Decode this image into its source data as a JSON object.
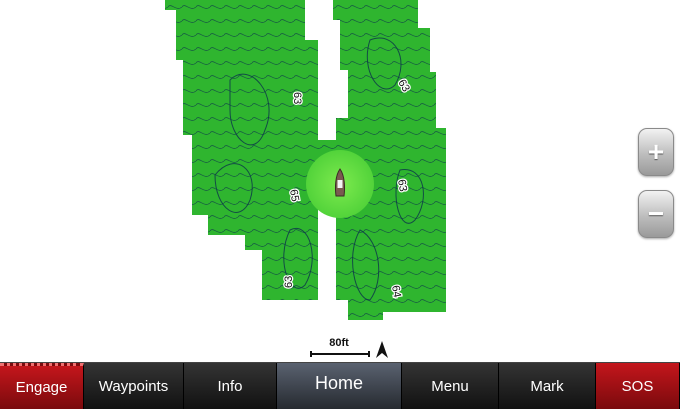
{
  "map": {
    "depth_labels": [
      "63",
      "63",
      "65",
      "63",
      "63",
      "64"
    ],
    "colors": {
      "shallow_fill": "#2fb52f",
      "contour": "#0d3a4a",
      "highlight": "#7dea4e"
    }
  },
  "zoom": {
    "in_label": "+",
    "out_label": "−"
  },
  "scale": {
    "label": "80ft"
  },
  "toolbar": {
    "engage": "Engage",
    "waypoints": "Waypoints",
    "info": "Info",
    "home": "Home",
    "menu": "Menu",
    "mark": "Mark",
    "sos": "SOS"
  }
}
